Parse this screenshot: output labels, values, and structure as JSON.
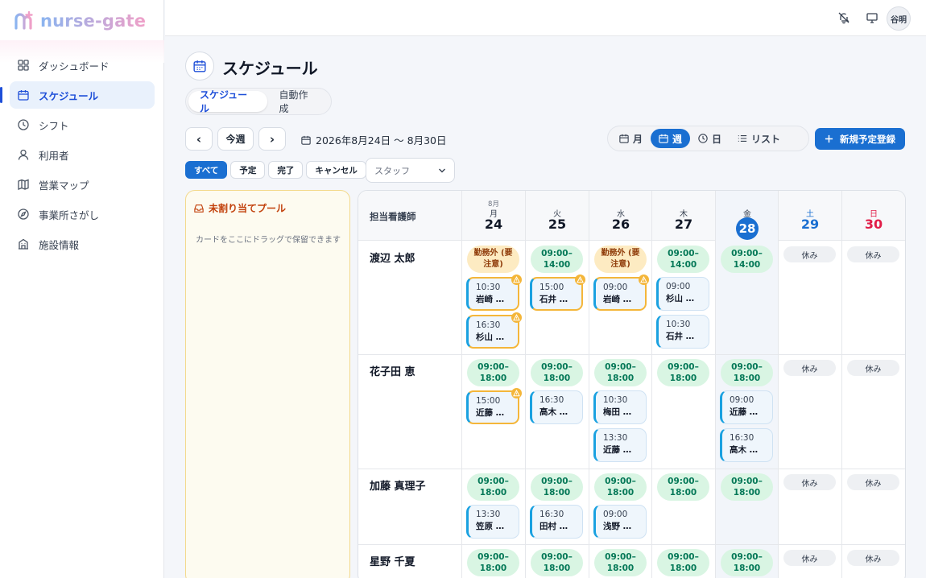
{
  "app": {
    "logo_text": "nurse-gate"
  },
  "sidebar": {
    "items": [
      {
        "label": "ダッシュボード",
        "icon": "dashboard-icon"
      },
      {
        "label": "スケジュール",
        "icon": "calendar-icon"
      },
      {
        "label": "シフト",
        "icon": "clock-icon"
      },
      {
        "label": "利用者",
        "icon": "user-icon"
      },
      {
        "label": "営業マップ",
        "icon": "map-icon"
      },
      {
        "label": "事業所さがし",
        "icon": "compass-icon"
      },
      {
        "label": "施設情報",
        "icon": "building-icon"
      }
    ]
  },
  "topbar": {
    "avatar": "谷明",
    "icons": [
      "bell-off-icon",
      "monitor-icon"
    ]
  },
  "page": {
    "title": "スケジュール"
  },
  "subtabs": [
    "スケジュール",
    "自動作成"
  ],
  "nav": {
    "prev": "‹",
    "today": "今週",
    "next": "›",
    "date_range": "2026年8月24日 〜 8月30日"
  },
  "views": [
    "月",
    "週",
    "日",
    "リスト"
  ],
  "new_button": "新規予定登録",
  "filters": [
    "すべて",
    "予定",
    "完了",
    "キャンセル"
  ],
  "staff_select": {
    "placeholder": "スタッフ"
  },
  "pool": {
    "title": "未割り当てプール",
    "hint": "カードをここにドラッグで保留できます"
  },
  "grid": {
    "header_label": "担当看護師",
    "days": [
      {
        "month": "8月",
        "weekday": "月",
        "day": "24"
      },
      {
        "month": "",
        "weekday": "火",
        "day": "25"
      },
      {
        "month": "",
        "weekday": "水",
        "day": "26"
      },
      {
        "month": "",
        "weekday": "木",
        "day": "27"
      },
      {
        "month": "",
        "weekday": "金",
        "day": "28"
      },
      {
        "month": "",
        "weekday": "土",
        "day": "29"
      },
      {
        "month": "",
        "weekday": "日",
        "day": "30"
      }
    ],
    "colors": {
      "today": "#1a6fd1",
      "saturday": "#1a6fd1",
      "sunday": "#e11d48"
    },
    "nurses": [
      {
        "name": "渡辺 太郎",
        "days": [
          {
            "shift": "勤務外 (要\n注意)",
            "warn": true,
            "visits": [
              {
                "time": "10:30",
                "name": "岩崎 …",
                "alert": true
              },
              {
                "time": "16:30",
                "name": "杉山 …",
                "alert": true
              }
            ]
          },
          {
            "shift": "09:00–\n14:00",
            "visits": [
              {
                "time": "15:00",
                "name": "石井 …",
                "alert": true
              }
            ]
          },
          {
            "shift": "勤務外 (要\n注意)",
            "warn": true,
            "visits": [
              {
                "time": "09:00",
                "name": "岩崎 …",
                "alert": true
              }
            ]
          },
          {
            "shift": "09:00–\n14:00",
            "visits": [
              {
                "time": "09:00",
                "name": "杉山 …"
              },
              {
                "time": "10:30",
                "name": "石井 …"
              }
            ]
          },
          {
            "shift": "09:00–\n14:00",
            "visits": []
          },
          {
            "off": "休み"
          },
          {
            "off": "休み"
          }
        ]
      },
      {
        "name": "花子田 恵",
        "days": [
          {
            "shift": "09:00–\n18:00",
            "visits": [
              {
                "time": "15:00",
                "name": "近藤 …",
                "alert": true
              }
            ]
          },
          {
            "shift": "09:00–\n18:00",
            "visits": [
              {
                "time": "16:30",
                "name": "高木 …"
              }
            ]
          },
          {
            "shift": "09:00–\n18:00",
            "visits": [
              {
                "time": "10:30",
                "name": "梅田 …"
              },
              {
                "time": "13:30",
                "name": "近藤 …"
              }
            ]
          },
          {
            "shift": "09:00–\n18:00",
            "visits": []
          },
          {
            "shift": "09:00–\n18:00",
            "visits": [
              {
                "time": "09:00",
                "name": "近藤 …"
              },
              {
                "time": "16:30",
                "name": "高木 …"
              }
            ]
          },
          {
            "off": "休み"
          },
          {
            "off": "休み"
          }
        ]
      },
      {
        "name": "加藤 真理子",
        "days": [
          {
            "shift": "09:00–\n18:00",
            "visits": [
              {
                "time": "13:30",
                "name": "笠原 …"
              }
            ]
          },
          {
            "shift": "09:00–\n18:00",
            "visits": [
              {
                "time": "16:30",
                "name": "田村 …"
              }
            ]
          },
          {
            "shift": "09:00–\n18:00",
            "visits": [
              {
                "time": "09:00",
                "name": "浅野 …"
              }
            ]
          },
          {
            "shift": "09:00–\n18:00",
            "visits": []
          },
          {
            "shift": "09:00–\n18:00",
            "visits": []
          },
          {
            "off": "休み"
          },
          {
            "off": "休み"
          }
        ]
      },
      {
        "name": "星野 千夏",
        "days": [
          {
            "shift": "09:00–\n18:00",
            "visits": []
          },
          {
            "shift": "09:00–\n18:00",
            "visits": []
          },
          {
            "shift": "09:00–\n18:00",
            "visits": []
          },
          {
            "shift": "09:00–\n18:00",
            "visits": []
          },
          {
            "shift": "09:00–\n18:00",
            "visits": []
          },
          {
            "off": "休み"
          },
          {
            "off": "休み"
          }
        ]
      }
    ]
  }
}
